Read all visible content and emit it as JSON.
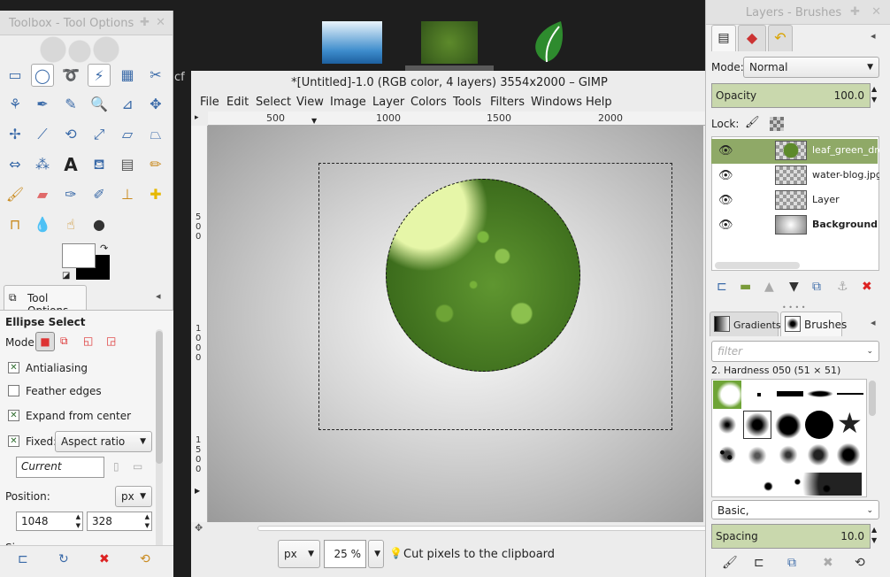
{
  "desktop": {
    "cf_text": "cf"
  },
  "toolbox": {
    "title": "Toolbox - Tool Options"
  },
  "tool_options": {
    "tab": "Tool Options",
    "tool_name": "Ellipse Select",
    "mode_label": "Mode:",
    "antialiasing": "Antialiasing",
    "feather": "Feather edges",
    "expand": "Expand from center",
    "fixed_label": "Fixed:",
    "fixed_value": "Aspect ratio",
    "current_value": "Current",
    "position_label": "Position:",
    "unit": "px",
    "pos_x": "1048",
    "pos_y": "328",
    "size_label": "Size:"
  },
  "window": {
    "title": "*[Untitled]-1.0 (RGB color, 4 layers) 3554x2000 – GIMP"
  },
  "menu": [
    "File",
    "Edit",
    "Select",
    "View",
    "Image",
    "Layer",
    "Colors",
    "Tools",
    "Filters",
    "Windows",
    "Help"
  ],
  "ruler": {
    "h": [
      "500",
      "1000",
      "1500",
      "2000"
    ],
    "v": [
      "5\n0\n0",
      "1\n0\n0\n0",
      "1\n5\n0\n0"
    ]
  },
  "status": {
    "unit": "px",
    "zoom": "25 %",
    "message": "Cut pixels to the clipboard"
  },
  "layers": {
    "title": "Layers - Brushes",
    "mode_label": "Mode:",
    "mode_value": "Normal",
    "opacity_label": "Opacity",
    "opacity_value": "100.0",
    "lock_label": "Lock:",
    "items": [
      {
        "name": "leaf_green_drop"
      },
      {
        "name": "water-blog.jpg"
      },
      {
        "name": "Layer"
      },
      {
        "name": "Background"
      }
    ]
  },
  "brushes": {
    "tab_gradients": "Gradients",
    "tab_brushes": "Brushes",
    "filter_placeholder": "filter",
    "current": "2. Hardness 050 (51 × 51)",
    "preset": "Basic,",
    "spacing_label": "Spacing",
    "spacing_value": "10.0"
  },
  "colors": {
    "accent": "#a9c27d",
    "selection": "#6e9b3c"
  }
}
